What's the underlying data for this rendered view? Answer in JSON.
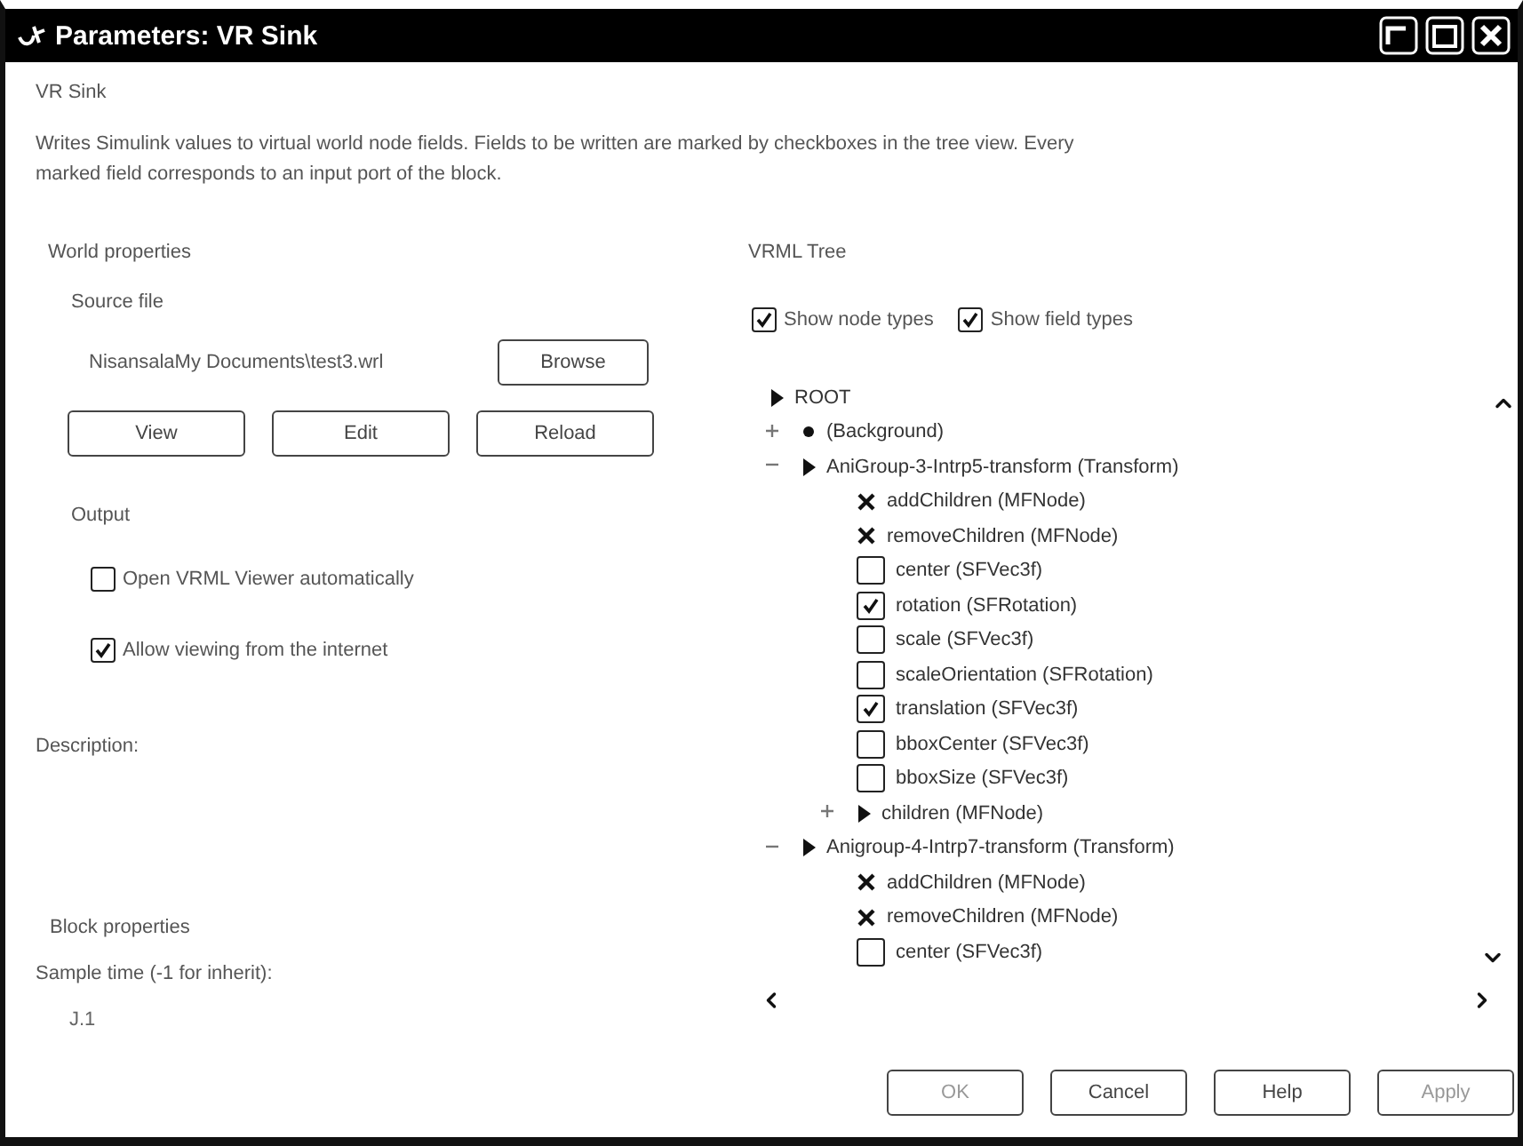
{
  "window": {
    "title": "Parameters: VR Sink"
  },
  "block_name": "VR Sink",
  "description": "Writes Simulink values to virtual world node fields. Fields to be written are marked by checkboxes in the tree view. Every marked field corresponds to an input port of the block.",
  "world_properties": {
    "heading": "World properties",
    "source_file_label": "Source file",
    "path": "NisansalaMy Documents\\test3.wrl",
    "browse_button": "Browse",
    "buttons": [
      "View",
      "Edit",
      "Reload"
    ],
    "output_label": "Output",
    "options": [
      {
        "label": "Open VRML Viewer automatically",
        "checked": false
      },
      {
        "label": "Allow viewing from the internet",
        "checked": true
      }
    ]
  },
  "description_label": "Description:",
  "block_properties": {
    "heading": "Block properties",
    "sample_time_label": "Sample time (-1 for inherit):",
    "sample_time_value": "J.1"
  },
  "vrml_tree": {
    "heading": "VRML Tree",
    "toggles": [
      {
        "label": "Show node types",
        "checked": true
      },
      {
        "label": "Show field types",
        "checked": true
      }
    ],
    "nodes": [
      {
        "kind": "node",
        "label": "ROOT",
        "children": [
          {
            "kind": "leaf",
            "label": "(Background)",
            "expanded": false
          },
          {
            "kind": "node",
            "label": "AniGroup-3-Intrp5-transform (Transform)",
            "expanded": true,
            "children": [
              {
                "kind": "event",
                "label": "addChildren (MFNode)"
              },
              {
                "kind": "event",
                "label": "removeChildren (MFNode)"
              },
              {
                "kind": "field",
                "label": "center (SFVec3f)",
                "checked": false
              },
              {
                "kind": "field",
                "label": "rotation (SFRotation)",
                "checked": true
              },
              {
                "kind": "field",
                "label": "scale (SFVec3f)",
                "checked": false
              },
              {
                "kind": "field",
                "label": "scaleOrientation (SFRotation)",
                "checked": false
              },
              {
                "kind": "field",
                "label": "translation (SFVec3f)",
                "checked": true
              },
              {
                "kind": "field",
                "label": "bboxCenter (SFVec3f)",
                "checked": false
              },
              {
                "kind": "field",
                "label": "bboxSize (SFVec3f)",
                "checked": false
              },
              {
                "kind": "node",
                "label": "children (MFNode)",
                "expanded": false
              }
            ]
          },
          {
            "kind": "node",
            "label": "Anigroup-4-Intrp7-transform (Transform)",
            "expanded": true,
            "children": [
              {
                "kind": "event",
                "label": "addChildren (MFNode)"
              },
              {
                "kind": "event",
                "label": "removeChildren (MFNode)"
              },
              {
                "kind": "field",
                "label": "center (SFVec3f)",
                "checked": false
              }
            ]
          }
        ]
      }
    ]
  },
  "dialog_buttons": [
    {
      "label": "OK",
      "disabled": true
    },
    {
      "label": "Cancel",
      "disabled": false
    },
    {
      "label": "Help",
      "disabled": false
    },
    {
      "label": "Apply",
      "disabled": true
    }
  ]
}
